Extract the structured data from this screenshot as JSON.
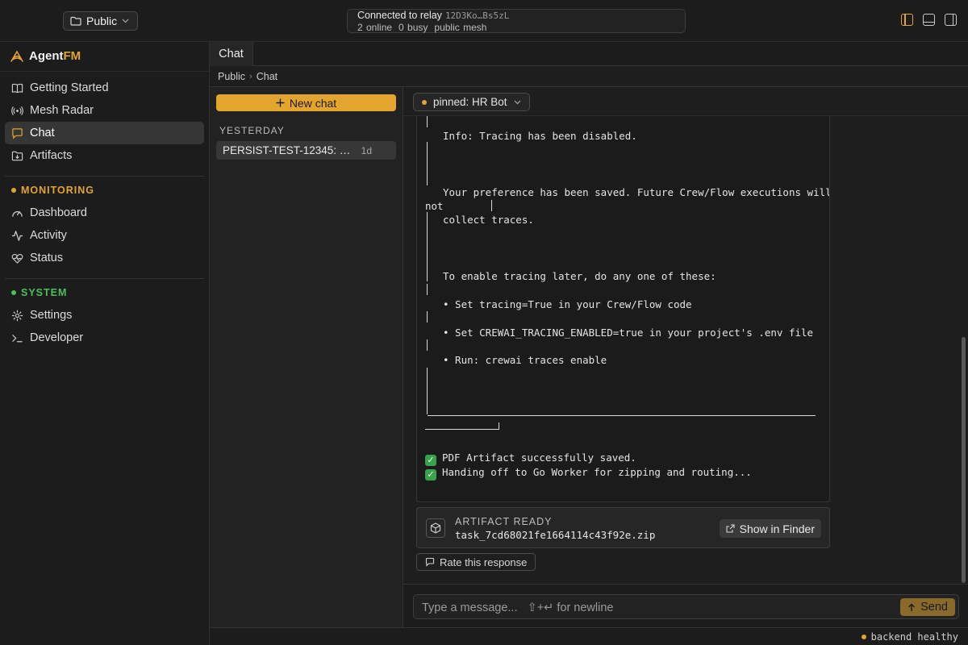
{
  "topbar": {
    "workspace": "Public",
    "relay_status": "Connected to relay",
    "relay_peer": "12D3Ko…Bs5zL",
    "online": "2 online",
    "busy": "0 busy",
    "mesh": "public mesh"
  },
  "brand": {
    "name_a": "Agent",
    "name_b": "FM"
  },
  "sidebar": {
    "nav": [
      {
        "label": "Getting Started",
        "icon": "book-icon"
      },
      {
        "label": "Mesh Radar",
        "icon": "radar-icon"
      },
      {
        "label": "Chat",
        "icon": "chat-icon",
        "active": true
      },
      {
        "label": "Artifacts",
        "icon": "folder-download-icon"
      }
    ],
    "monitoring_label": "MONITORING",
    "monitoring": [
      {
        "label": "Dashboard",
        "icon": "gauge-icon"
      },
      {
        "label": "Activity",
        "icon": "activity-icon"
      },
      {
        "label": "Status",
        "icon": "heart-pulse-icon"
      }
    ],
    "system_label": "SYSTEM",
    "system": [
      {
        "label": "Settings",
        "icon": "gear-icon"
      },
      {
        "label": "Developer",
        "icon": "terminal-icon"
      }
    ],
    "colors": {
      "monitoring": "#e3a52e",
      "system": "#4cbf5a"
    }
  },
  "main": {
    "tab": "Chat",
    "breadcrumb": [
      "Public",
      "Chat"
    ]
  },
  "chatlist": {
    "new_chat": "New chat",
    "group": "YESTERDAY",
    "items": [
      {
        "title": "PERSIST-TEST-12345: …",
        "age": "1d"
      }
    ]
  },
  "conversation": {
    "pinned": "pinned: HR Bot",
    "log": {
      "tracing_disabled": "Info: Tracing has been disabled.",
      "pref_saved": "Your preference has been saved. Future Crew/Flow executions will",
      "pref_saved_wrap": "not",
      "collect": "collect traces.",
      "enable_later": "To enable tracing later, do any one of these:",
      "opt1": "• Set tracing=True in your Crew/Flow code",
      "opt2": "• Set CREWAI_TRACING_ENABLED=true in your project's .env file",
      "opt3": "• Run: crewai traces enable",
      "success1": "PDF Artifact successfully saved.",
      "success2": "Handing off to Go Worker for zipping and routing..."
    },
    "artifact": {
      "label": "ARTIFACT READY",
      "file": "task_7cd68021fe1664114c43f92e.zip",
      "action": "Show in Finder"
    },
    "rate": "Rate this response"
  },
  "composer": {
    "placeholder": "Type a message...   ⇧+↵ for newline",
    "send": "Send"
  },
  "statusbar": {
    "health": "backend healthy"
  },
  "accent": "#e3a52e"
}
